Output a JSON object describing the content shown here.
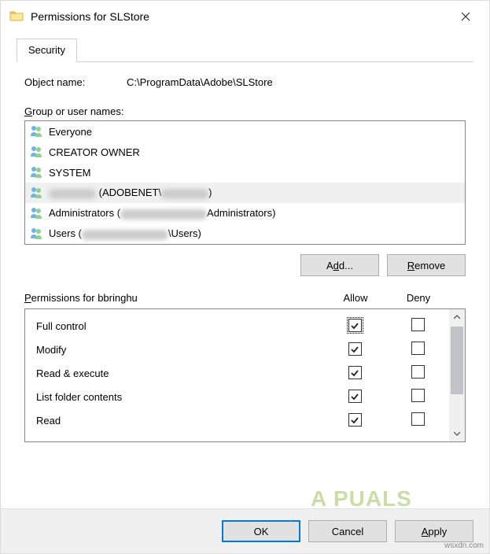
{
  "window": {
    "title": "Permissions for SLStore"
  },
  "tabs": {
    "security": "Security"
  },
  "object": {
    "label": "Object name:",
    "value": "C:\\ProgramData\\Adobe\\SLStore"
  },
  "groups": {
    "label_pre": "G",
    "label_post": "roup or user names:",
    "items": [
      {
        "text": "Everyone"
      },
      {
        "text": "CREATOR OWNER"
      },
      {
        "text": "SYSTEM"
      },
      {
        "prefix": "",
        "mid": " (ADOBENET\\",
        "suffix": ")",
        "selected": true,
        "redacted": true
      },
      {
        "prefix": "Administrators (",
        "suffix": "Administrators)",
        "redacted2": true
      },
      {
        "prefix": "Users (",
        "suffix": "\\Users)",
        "redacted2": true
      }
    ]
  },
  "buttons": {
    "add_pre": "A",
    "add_u": "d",
    "add_post": "d...",
    "remove_pre": "",
    "remove_u": "R",
    "remove_post": "emove",
    "ok": "OK",
    "cancel": "Cancel",
    "apply_pre": "",
    "apply_u": "A",
    "apply_post": "pply"
  },
  "perm": {
    "header_pre": "P",
    "header_post": "ermissions for bbringhu",
    "allow": "Allow",
    "deny": "Deny",
    "rows": [
      {
        "name": "Full control",
        "allow": true,
        "deny": false,
        "focus": true
      },
      {
        "name": "Modify",
        "allow": true,
        "deny": false
      },
      {
        "name": "Read & execute",
        "allow": true,
        "deny": false
      },
      {
        "name": "List folder contents",
        "allow": true,
        "deny": false
      },
      {
        "name": "Read",
        "allow": true,
        "deny": false
      }
    ]
  },
  "watermark": {
    "logo": "A PUALS",
    "site": "wsxdn.com"
  }
}
